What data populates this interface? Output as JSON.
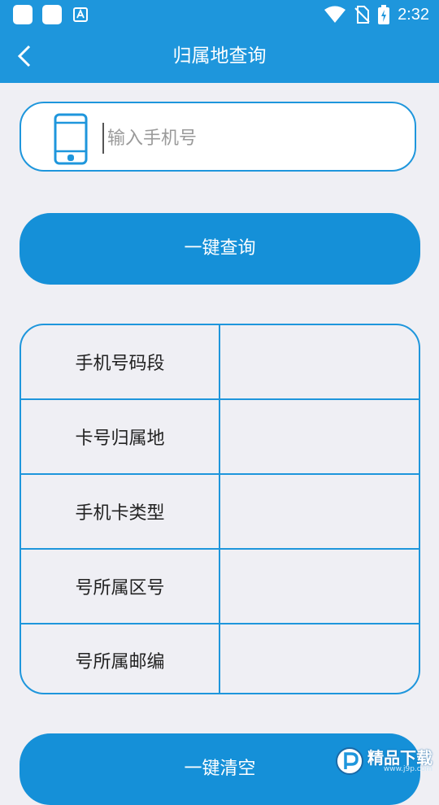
{
  "status_bar": {
    "time": "2:32"
  },
  "header": {
    "title": "归属地查询"
  },
  "search": {
    "placeholder": "输入手机号",
    "value": ""
  },
  "buttons": {
    "query_label": "一键查询",
    "clear_label": "一键清空"
  },
  "result_rows": [
    {
      "label": "手机号码段",
      "value": ""
    },
    {
      "label": "卡号归属地",
      "value": ""
    },
    {
      "label": "手机卡类型",
      "value": ""
    },
    {
      "label": "号所属区号",
      "value": ""
    },
    {
      "label": "号所属邮编",
      "value": ""
    }
  ],
  "watermark": {
    "text": "精品下载",
    "sub": "www.j9p.com"
  },
  "colors": {
    "accent": "#1e96dc",
    "button": "#1590d8",
    "background": "#efeff4"
  },
  "icons": [
    "back-arrow-icon",
    "phone-icon",
    "wifi-icon",
    "no-sim-icon",
    "battery-icon"
  ]
}
